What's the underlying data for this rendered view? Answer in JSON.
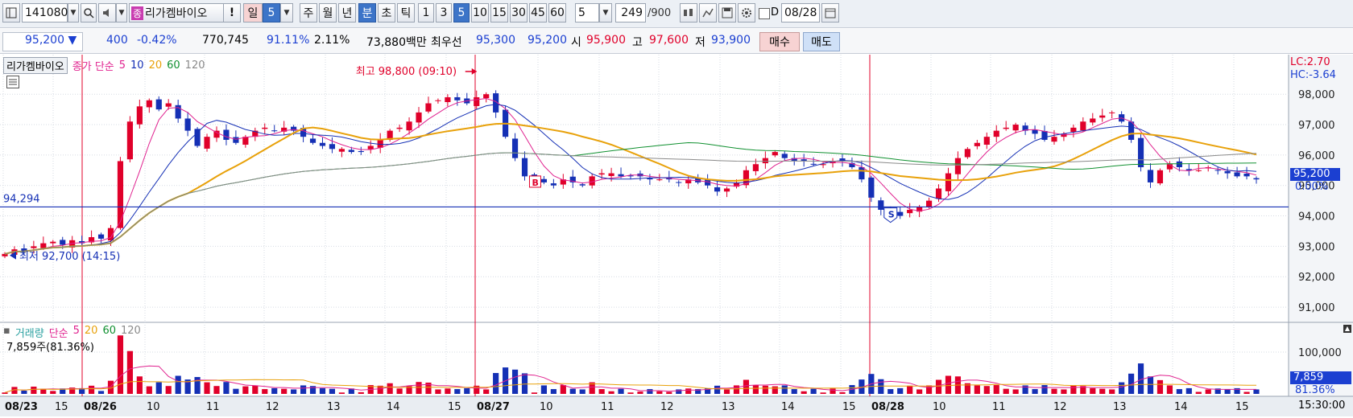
{
  "toolbar": {
    "code": "141080",
    "name": "리가켐바이오",
    "name_badge": "종",
    "alert_label": "!",
    "period_day": "일",
    "period_day_value": "5",
    "period_week": "주",
    "period_month": "월",
    "period_year": "년",
    "period_minute": "분",
    "period_second": "초",
    "period_tick": "틱",
    "intervals": [
      "1",
      "3",
      "5",
      "10",
      "15",
      "30",
      "45",
      "60"
    ],
    "selected_interval": "5",
    "count_value": "5",
    "bars_shown": "249",
    "bars_total": "/900",
    "date_value": "08/28"
  },
  "quote": {
    "price": "95,200",
    "direction": "▼",
    "change": "400",
    "change_pct": "-0.42%",
    "volume": "770,745",
    "volume_ratio": "91.11%",
    "turnover": "2.11%",
    "amount": "73,880백만",
    "best_bid_label": "최우선",
    "best_ask": "95,300",
    "best_bid": "95,200",
    "open_label": "시",
    "open": "95,900",
    "high_label": "고",
    "high": "97,600",
    "low_label": "저",
    "low": "93,900",
    "buy_button": "매수",
    "sell_button": "매도"
  },
  "chart_data": {
    "type": "candlestick",
    "price_panel": {
      "legend_name": "리가켐바이오",
      "legend_series": "종가 단순",
      "ma_periods": [
        "5",
        "10",
        "20",
        "60",
        "120"
      ],
      "ma_colors": {
        "5": "#e0228f",
        "10": "#1530b5",
        "20": "#e8a10a",
        "60": "#109030",
        "120": "#8a8a8a"
      },
      "lc_label": "LC:2.70",
      "hc_label": "HC:-3.64",
      "y_ticks": [
        "98,000",
        "97,000",
        "96,000",
        "95,000",
        "94,000",
        "93,000",
        "92,000",
        "91,000"
      ],
      "ylim": [
        90500,
        99300
      ],
      "current_price_label": "95,200",
      "current_pct_label": "0.00%",
      "reference_line_label": "94,294",
      "reference_line_value": 94294,
      "high_annotation": "최고 98,800 (09:10)",
      "low_annotation": "최저 92,700 (14:15)",
      "marker_buy": "B",
      "marker_sell": "S"
    },
    "volume_panel": {
      "legend_name": "거래량",
      "legend_series": "단순",
      "ma_periods": [
        "5",
        "20",
        "60",
        "120"
      ],
      "last_label": "7,859주(81.36%)",
      "y_tick": "100,000",
      "current_label": "7,859",
      "current_pct": "81.36%"
    },
    "x_labels": [
      "08/23",
      "15",
      "08/26",
      "10",
      "11",
      "12",
      "13",
      "14",
      "15",
      "08/27",
      "10",
      "11",
      "12",
      "13",
      "14",
      "15",
      "08/28",
      "10",
      "11",
      "12",
      "13",
      "14",
      "15"
    ],
    "time_label": "15:30:00",
    "close_series": [
      92750,
      92900,
      92850,
      93000,
      93100,
      93150,
      93050,
      93200,
      93100,
      93300,
      93250,
      93600,
      95800,
      97100,
      97600,
      97800,
      97500,
      97700,
      97200,
      96800,
      96300,
      96600,
      96800,
      96500,
      96400,
      96600,
      96800,
      96900,
      96800,
      96900,
      96800,
      96600,
      96400,
      96300,
      96200,
      96200,
      96100,
      96100,
      96300,
      96500,
      96800,
      96900,
      97100,
      97400,
      97700,
      97800,
      97900,
      97800,
      97700,
      97900,
      98000,
      97400,
      96600,
      95900,
      95300,
      95300,
      95100,
      95000,
      95200,
      95100,
      95000,
      95300,
      95400,
      95400,
      95300,
      95300,
      95300,
      95200,
      95200,
      95200,
      95100,
      95200,
      95100,
      95000,
      94800,
      94900,
      95100,
      95500,
      95700,
      95900,
      96100,
      95900,
      95800,
      95800,
      95700,
      95700,
      95800,
      95800,
      95600,
      95200,
      94600,
      94200,
      94100,
      94000,
      94200,
      94300,
      94500,
      94900,
      95400,
      95900,
      96200,
      96400,
      96600,
      96800,
      96900,
      97000,
      96800,
      96700,
      96500,
      96600,
      96700,
      96900,
      97100,
      97200,
      97300,
      97400,
      97100,
      96500,
      95600,
      95100,
      95500,
      95700,
      95600,
      95500,
      95500,
      95600,
      95500,
      95400,
      95300,
      95300,
      95200
    ]
  }
}
